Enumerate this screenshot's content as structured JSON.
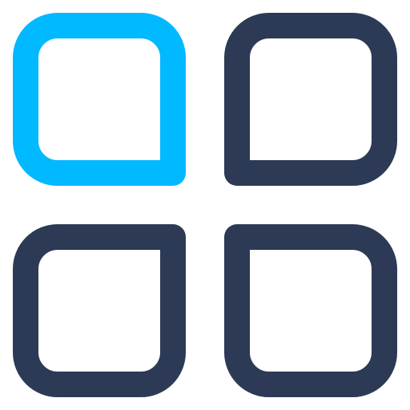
{
  "icon": {
    "name": "app-grid-icon",
    "tiles": [
      {
        "name": "top-left",
        "color": "#00B9FF",
        "sharp_corner": "bottom-right"
      },
      {
        "name": "top-right",
        "color": "#2C3A55",
        "sharp_corner": "bottom-left"
      },
      {
        "name": "bottom-left",
        "color": "#2C3A55",
        "sharp_corner": "top-right"
      },
      {
        "name": "bottom-right",
        "color": "#2C3A55",
        "sharp_corner": "top-left"
      }
    ]
  }
}
